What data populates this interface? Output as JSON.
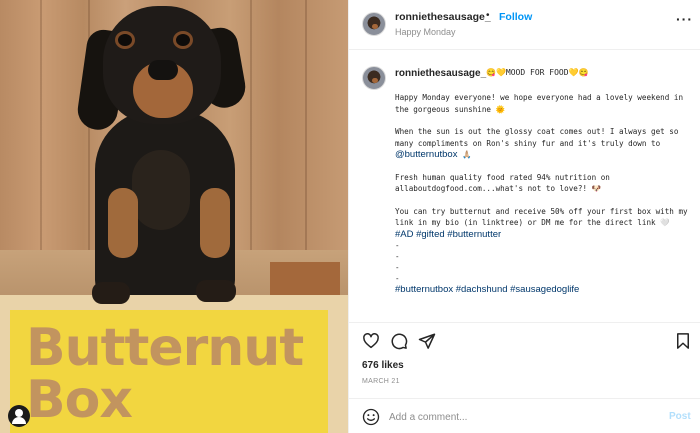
{
  "photo": {
    "box_text_line1": "Butternut",
    "box_text_line2": "Box"
  },
  "header": {
    "username": "ronniethesausage_",
    "separator": "•",
    "follow_label": "Follow",
    "location": "Happy Monday",
    "more_label": "···"
  },
  "caption": {
    "username": "ronniethesausage_",
    "title": "😋💛MOOD FOR FOOD💛😋",
    "paragraph1": "Happy Monday everyone! we hope everyone had a lovely weekend in the gorgeous sunshine 🌞",
    "paragraph2_text": "When the sun is out the glossy coat comes out! I always get so many compliments on Ron's shiny fur and it's truly down to",
    "paragraph2_mention": "@butternutbox",
    "paragraph2_emoji": " 🙏🏼",
    "paragraph3": "Fresh human quality food rated 94% nutrition on allaboutdogfood.com...what's not to love?! 🐶",
    "paragraph4": "You can try butternut and receive 50% off your first box with my link in my bio (in linktree) or DM me for the direct link 🤍",
    "hashtags_top": "#AD #gifted #butternutter",
    "dash1": "-",
    "dash2": "-",
    "dash3": "-",
    "dash4": "-",
    "hashtags_bottom": "#butternutbox #dachshund #sausagedoglife"
  },
  "actions": {
    "like_icon": "heart-icon",
    "comment_icon": "comment-icon",
    "share_icon": "paper-plane-icon",
    "save_icon": "bookmark-icon"
  },
  "likes": "676 likes",
  "date": "MARCH 21",
  "comment": {
    "placeholder": "Add a comment...",
    "post_label": "Post",
    "emoji_icon": "smiley-icon"
  },
  "colors": {
    "accent": "#0095f6",
    "link": "#00376b",
    "muted": "#8e8e8e",
    "post_disabled": "#b2dffc"
  }
}
